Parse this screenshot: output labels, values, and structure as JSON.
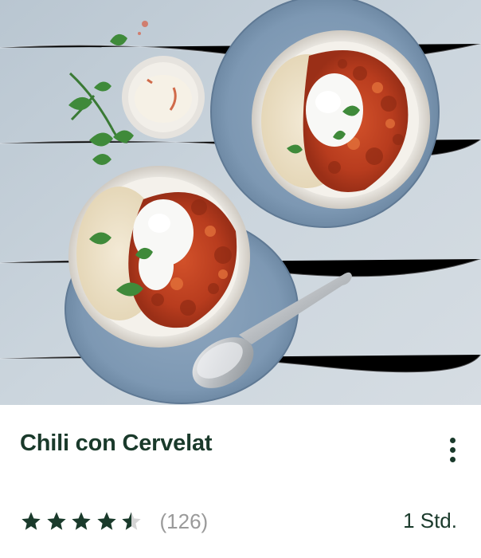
{
  "recipe": {
    "title": "Chili con Cervelat",
    "rating": 4.5,
    "rating_count": "(126)",
    "duration": "1 Std."
  },
  "image": {
    "subject": "chili-con-cervelat-photo"
  },
  "colors": {
    "title": "#1a3a2b",
    "star_filled": "#1a3a2b",
    "star_empty": "#d4d4d4",
    "count": "#9a9a9a",
    "background_photo": "#c9d3db"
  },
  "menu": {
    "icon": "more-vertical-icon"
  }
}
